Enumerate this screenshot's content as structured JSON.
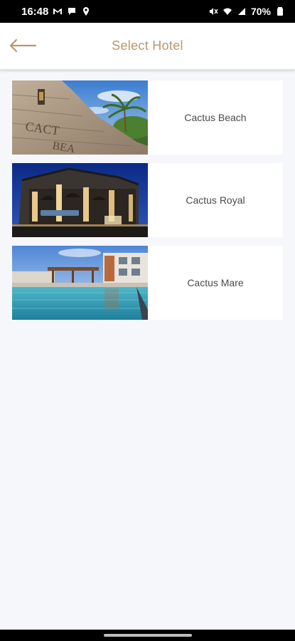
{
  "status_bar": {
    "time": "16:48",
    "battery": "70%",
    "left_icons": [
      "gmail-icon",
      "chat-icon",
      "location-icon"
    ],
    "right_icons": [
      "mute-icon",
      "wifi-icon",
      "signal-icon",
      "battery-icon"
    ]
  },
  "header": {
    "title": "Select Hotel",
    "back_icon": "arrow-left-icon",
    "accent_color": "#b9986c"
  },
  "hotels": [
    {
      "name": "Cactus Beach"
    },
    {
      "name": "Cactus Royal"
    },
    {
      "name": "Cactus Mare"
    }
  ]
}
